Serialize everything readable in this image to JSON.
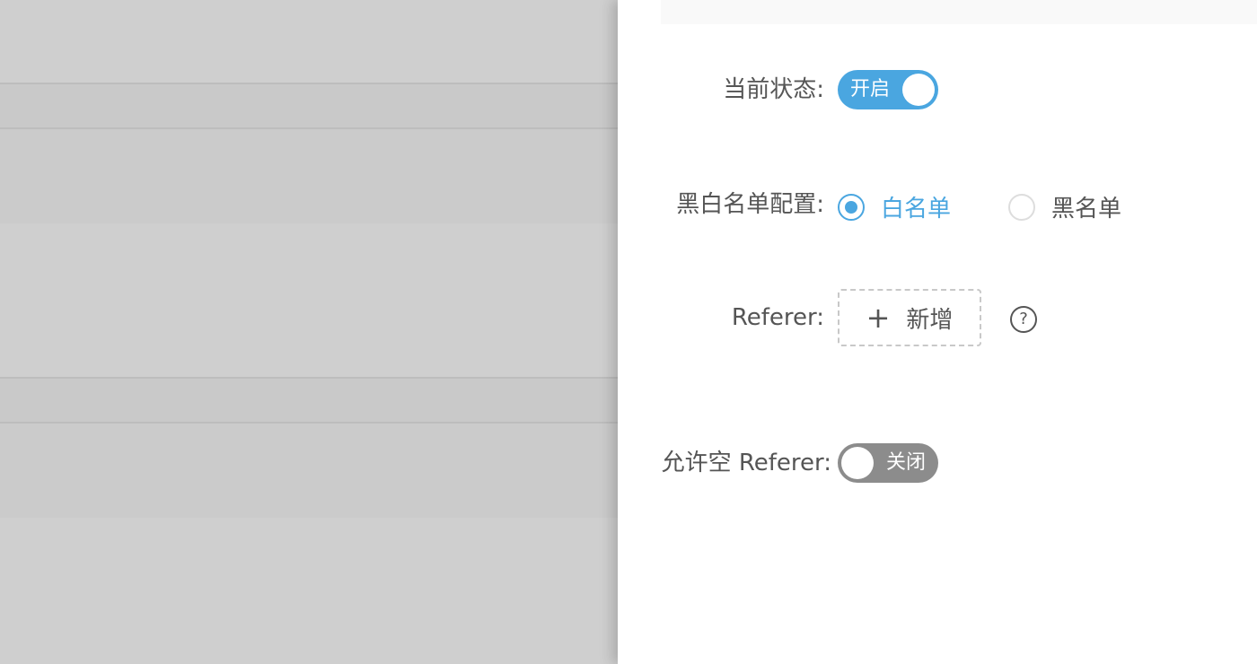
{
  "drawer": {
    "status": {
      "label": "当前状态:",
      "switch_text": "开启",
      "enabled": true
    },
    "list_config": {
      "label": "黑白名单配置:",
      "options": [
        {
          "label": "白名单",
          "checked": true
        },
        {
          "label": "黑名单",
          "checked": false
        }
      ]
    },
    "referer": {
      "label": "Referer:",
      "add_label": "新增",
      "help_icon": "question-circle-icon"
    },
    "allow_empty": {
      "label": "允许空 Referer:",
      "switch_text": "关闭",
      "enabled": false
    }
  },
  "colors": {
    "accent": "#4aa6e0",
    "switch_off": "#8c8c8c",
    "text": "#555555",
    "backdrop": "#cfcfcf"
  }
}
